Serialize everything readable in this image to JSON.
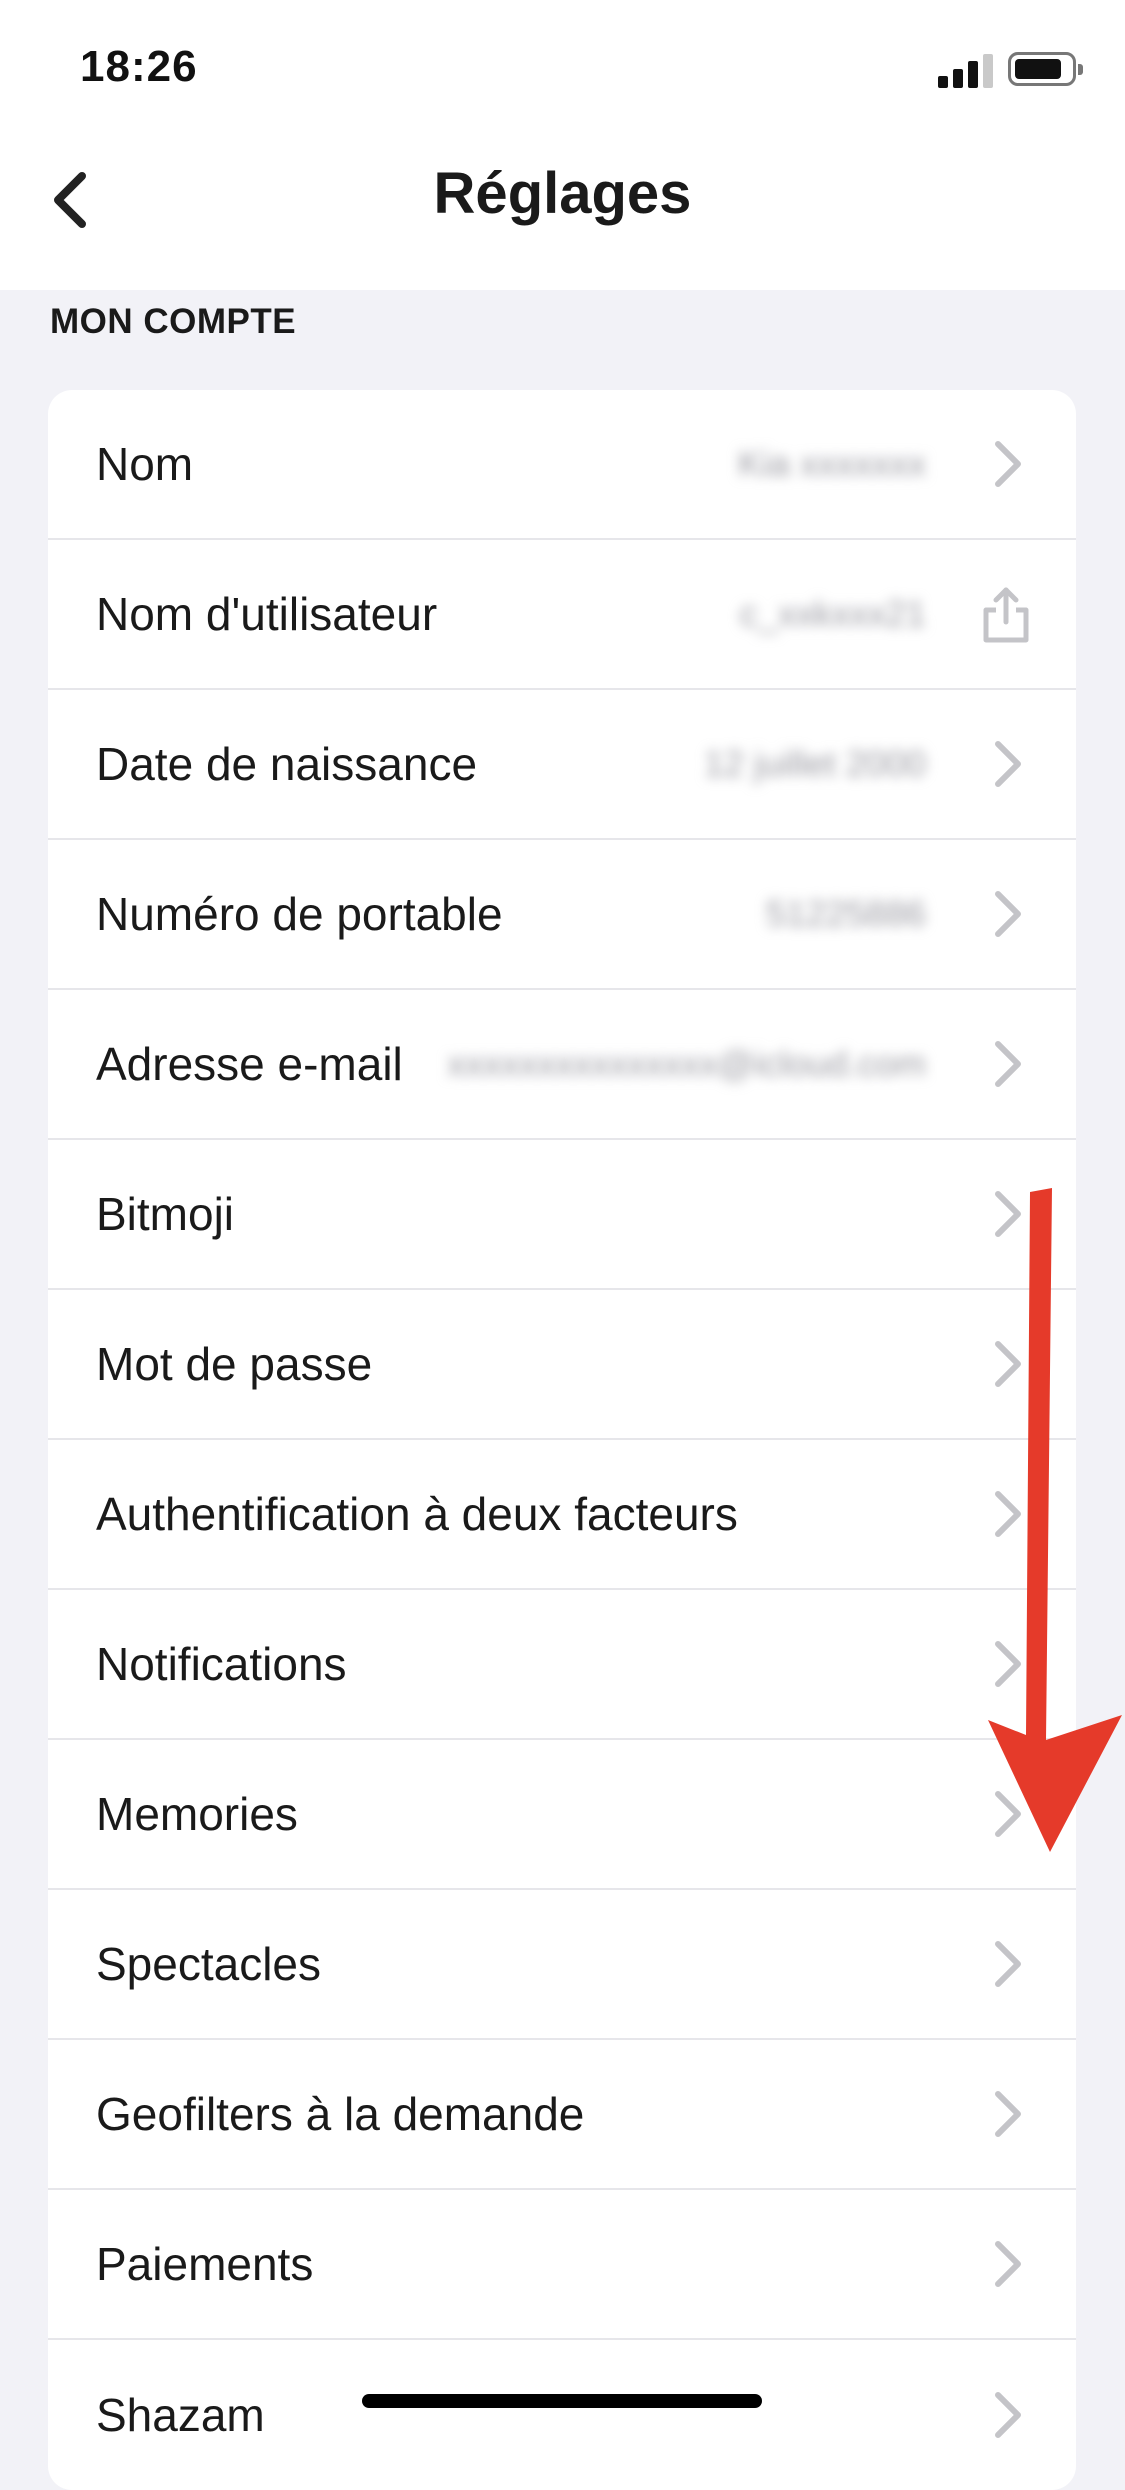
{
  "status_bar": {
    "time": "18:26"
  },
  "header": {
    "title": "Réglages",
    "back_icon": "chevron-left-icon"
  },
  "section": {
    "label": "MON COMPTE"
  },
  "rows": [
    {
      "label": "Nom",
      "value": "Kia xxxxxxx",
      "icon": "chevron-right-icon"
    },
    {
      "label": "Nom d'utilisateur",
      "value": "c_xxkxxx21",
      "icon": "share-icon"
    },
    {
      "label": "Date de naissance",
      "value": "12 juillet 2000",
      "icon": "chevron-right-icon"
    },
    {
      "label": "Numéro de portable",
      "value": "51225886",
      "icon": "chevron-right-icon"
    },
    {
      "label": "Adresse e-mail",
      "value": "xxxxxxxxxxxxxxx@icloud.com",
      "icon": "chevron-right-icon"
    },
    {
      "label": "Bitmoji",
      "value": "",
      "icon": "chevron-right-icon"
    },
    {
      "label": "Mot de passe",
      "value": "",
      "icon": "chevron-right-icon"
    },
    {
      "label": "Authentification à deux facteurs",
      "value": "",
      "icon": "chevron-right-icon"
    },
    {
      "label": "Notifications",
      "value": "",
      "icon": "chevron-right-icon"
    },
    {
      "label": "Memories",
      "value": "",
      "icon": "chevron-right-icon"
    },
    {
      "label": "Spectacles",
      "value": "",
      "icon": "chevron-right-icon"
    },
    {
      "label": "Geofilters à la demande",
      "value": "",
      "icon": "chevron-right-icon"
    },
    {
      "label": "Paiements",
      "value": "",
      "icon": "chevron-right-icon"
    },
    {
      "label": "Shazam",
      "value": "",
      "icon": "chevron-right-icon"
    }
  ],
  "colors": {
    "background": "#f2f2f7",
    "card": "#ffffff",
    "separator": "#e6e6ea",
    "chevron": "#c4c4c8",
    "annotation_arrow": "#e53a2a"
  }
}
